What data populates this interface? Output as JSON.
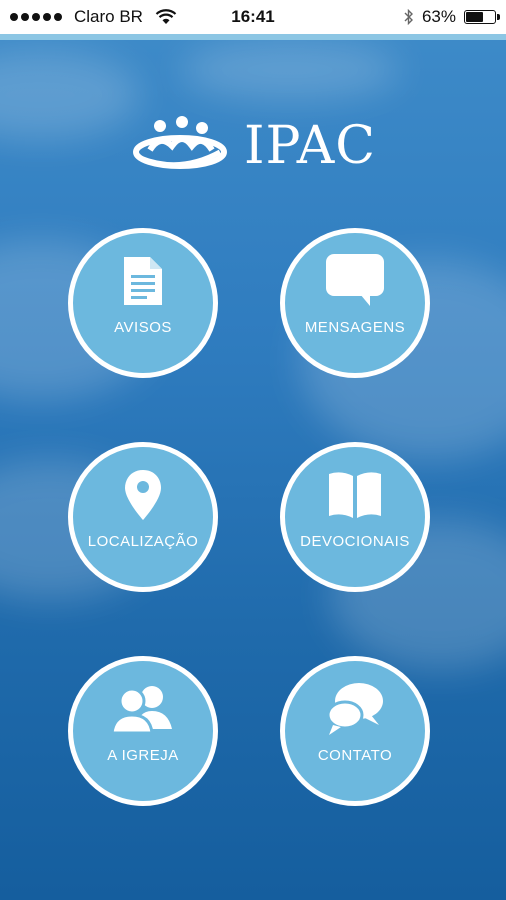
{
  "status_bar": {
    "carrier": "Claro BR",
    "time": "16:41",
    "battery_percent": "63%",
    "battery_level": 0.63,
    "signal_dots": 5
  },
  "brand": {
    "name": "IPAC"
  },
  "menu": {
    "avisos": "AVISOS",
    "mensagens": "MENSAGENS",
    "localizacao": "LOCALIZAÇÃO",
    "devocionais": "DEVOCIONAIS",
    "a_igreja": "A IGREJA",
    "contato": "CONTATO"
  },
  "icons": {
    "avisos": "document-icon",
    "mensagens": "speech-bubble-icon",
    "localizacao": "map-pin-icon",
    "devocionais": "open-book-icon",
    "a_igreja": "people-icon",
    "contato": "chat-bubbles-icon"
  },
  "colors": {
    "circle_fill": "#6cb8de",
    "circle_border": "#ffffff",
    "sky_top": "#3d8ac8",
    "sky_bottom": "#155e9e"
  }
}
